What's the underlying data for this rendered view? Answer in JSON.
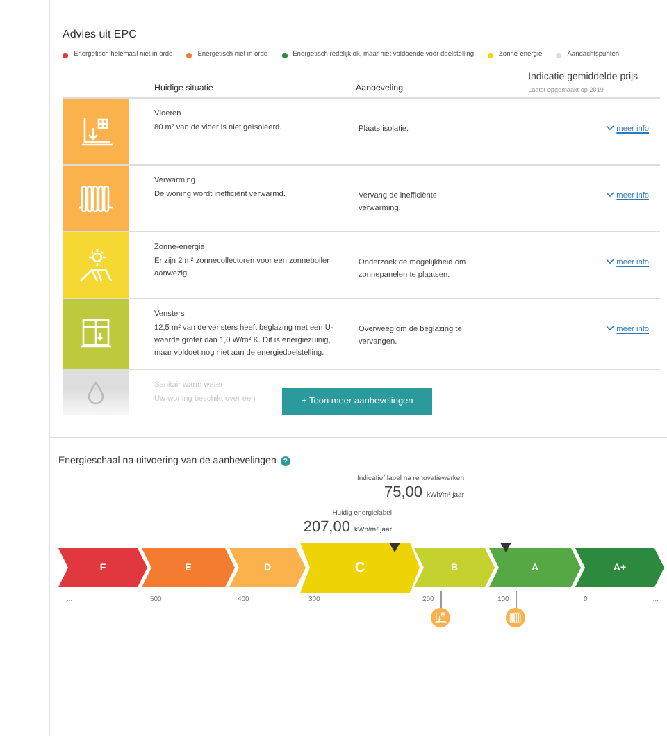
{
  "advice": {
    "title": "Advies uit EPC",
    "legend": [
      {
        "label": "Energetisch helemaal niet in orde",
        "color": "#e0383e"
      },
      {
        "label": "Energetisch niet in orde",
        "color": "#f47c30"
      },
      {
        "label": "Energetisch redelijk ok, maar niet voldoende voor doelstelling",
        "color": "#2e8b3e"
      },
      {
        "label": "Zonne-energie",
        "color": "#f5d50a"
      },
      {
        "label": "Aandachtspunten",
        "color": "#dddddd"
      }
    ],
    "columns": [
      "Huidige situatie",
      "Aanbeveling"
    ],
    "price_header": "Indicatie gemiddelde prijs",
    "price_note": "Laatst opgemaakt op 2019",
    "rows": [
      {
        "kind": "floor",
        "color": "#fbb24d",
        "title": "Vloeren",
        "situation": "80 m² van de vloer is niet geïsoleerd.",
        "advice": "Plaats isolatie.",
        "link": "meer info",
        "faded": false
      },
      {
        "kind": "heating",
        "color": "#fbb24d",
        "title": "Verwarming",
        "situation": "De woning wordt inefficiënt verwarmd.",
        "advice": "Vervang de inefficiënte verwarming.",
        "link": "meer info",
        "faded": false
      },
      {
        "kind": "solar",
        "color": "#f5d832",
        "title": "Zonne-energie",
        "situation": "Er zijn 2 m² zonnecollectoren voor een zonneboiler aanwezig.",
        "advice": "Onderzoek de mogelijkheid om zonnepanelen te plaatsen.",
        "link": "meer info",
        "faded": false
      },
      {
        "kind": "window",
        "color": "#bfc93d",
        "title": "Vensters",
        "situation": "12,5 m² van de vensters heeft beglazing met een U-waarde groter dan 1,0 W/m².K. Dit is energiezuinig, maar voldoet nog niet aan de energiedoelstelling.",
        "advice": "Overweeg om de beglazing te vervangen.",
        "link": "meer info",
        "faded": false
      },
      {
        "kind": "water",
        "color": "#dddddd",
        "title": "Sanitair warm water",
        "situation": "Uw woning beschikt over een",
        "faded": true
      }
    ],
    "more_button": "+ Toon meer aanbevelingen"
  },
  "scale": {
    "title": "Energieschaal na uitvoering van de aanbevelingen",
    "help": "?",
    "target_label": "Indicatief label na renovatiewerken",
    "target_value": "75,00",
    "target_unit": "kWh/m² jaar",
    "current_label": "Huidig energielabel",
    "current_value": "207,00",
    "current_unit": "kWh/m² jaar",
    "bands": [
      {
        "label": "F",
        "color": "#e0383e",
        "current": false,
        "target": false
      },
      {
        "label": "E",
        "color": "#f47c30",
        "current": false,
        "target": false
      },
      {
        "label": "D",
        "color": "#fbb24d",
        "current": false,
        "target": false
      },
      {
        "label": "C",
        "color": "#eed306",
        "current": true,
        "target": false
      },
      {
        "label": "B",
        "color": "#c5d12f",
        "current": false,
        "target": false,
        "pin": {
          "kind": "floor"
        }
      },
      {
        "label": "A",
        "color": "#56a845",
        "current": false,
        "target": true,
        "pin": {
          "kind": "heating"
        }
      },
      {
        "label": "A+",
        "color": "#2c8a3e",
        "current": false,
        "target": false
      }
    ],
    "ticks": [
      "...",
      "500",
      "400",
      "300",
      "200",
      "100",
      "0",
      "..."
    ]
  }
}
